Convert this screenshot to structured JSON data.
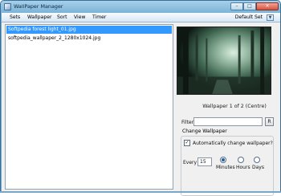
{
  "window": {
    "title": "WallPaper Manager"
  },
  "titlebar": {
    "min_icon": "minimize-icon",
    "max_icon": "maximize-icon",
    "close_icon": "close-icon"
  },
  "menu": {
    "items": [
      "Sets",
      "Wallpaper",
      "Sort",
      "View",
      "Timer"
    ],
    "default_set_label": "Default Set"
  },
  "list": {
    "rows": [
      {
        "label": "Softpedia forest light_01.jpg",
        "selected": true
      },
      {
        "label": "softpedia_wallpaper_2_1280x1024.jpg",
        "selected": false
      }
    ]
  },
  "preview": {
    "status": "Wallpaper 1 of 2 (Centre)"
  },
  "filter": {
    "label": "Filter:",
    "value": "",
    "button_label": "R"
  },
  "change_wallpaper": {
    "title": "Change Wallpaper",
    "automatic_label": "Automatically change wallpaper?",
    "automatic_checked": true,
    "every_label": "Every",
    "every_value": "15",
    "units": [
      "Minutes",
      "Hours",
      "Days"
    ],
    "selected_unit": "Minutes"
  },
  "colors": {
    "selection": "#3399ff",
    "window_border": "#3c6f96",
    "title_gradient_top": "#a7d0ea",
    "title_gradient_bottom": "#7ab3d7"
  }
}
